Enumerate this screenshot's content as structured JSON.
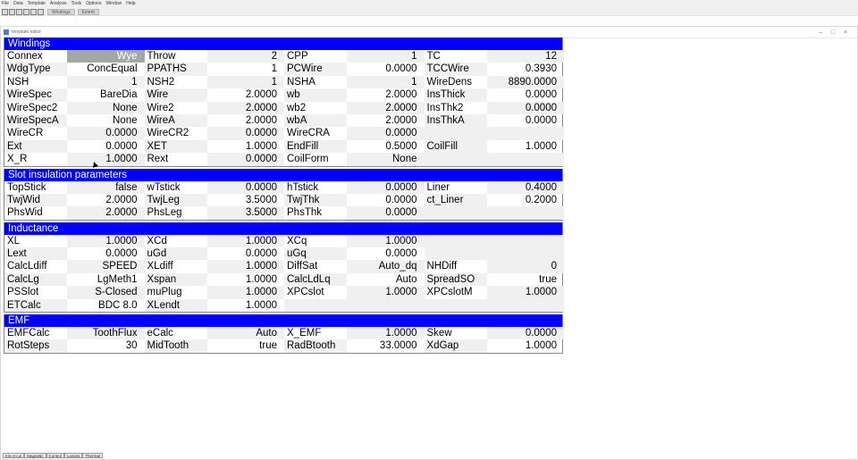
{
  "menu": [
    "File",
    "Data",
    "Template",
    "Analysis",
    "Tools",
    "Options",
    "Window",
    "Help"
  ],
  "toolbar": {
    "tabs": [
      "Windings",
      "Extent"
    ]
  },
  "window": {
    "title": "template editor"
  },
  "sections": [
    {
      "title": "Windings",
      "rows": [
        [
          [
            "Connex",
            "Wye"
          ],
          [
            "Throw",
            "2"
          ],
          [
            "CPP",
            "1"
          ],
          [
            "TC",
            "12"
          ]
        ],
        [
          [
            "WdgType",
            "ConcEqual"
          ],
          [
            "PPATHS",
            "1"
          ],
          [
            "PCWire",
            "0.0000"
          ],
          [
            "TCCWire",
            "0.3930"
          ]
        ],
        [
          [
            "NSH",
            "1"
          ],
          [
            "NSH2",
            "1"
          ],
          [
            "NSHA",
            "1"
          ],
          [
            "WireDens",
            "8890.0000"
          ]
        ],
        [
          [
            "WireSpec",
            "BareDia"
          ],
          [
            "Wire",
            "2.0000"
          ],
          [
            "wb",
            "2.0000"
          ],
          [
            "InsThick",
            "0.0000"
          ]
        ],
        [
          [
            "WireSpec2",
            "None"
          ],
          [
            "Wire2",
            "2.0000"
          ],
          [
            "wb2",
            "2.0000"
          ],
          [
            "InsThk2",
            "0.0000"
          ]
        ],
        [
          [
            "WireSpecA",
            "None"
          ],
          [
            "WireA",
            "2.0000"
          ],
          [
            "wbA",
            "2.0000"
          ],
          [
            "InsThkA",
            "0.0000"
          ]
        ],
        [
          [
            "WireCR",
            "0.0000"
          ],
          [
            "WireCR2",
            "0.0000"
          ],
          [
            "WireCRA",
            "0.0000"
          ],
          [
            "",
            ""
          ]
        ],
        [
          [
            "Ext",
            "0.0000"
          ],
          [
            "XET",
            "1.0000"
          ],
          [
            "EndFill",
            "0.5000"
          ],
          [
            "CoilFill",
            "1.0000"
          ]
        ],
        [
          [
            "X_R",
            "1.0000"
          ],
          [
            "Rext",
            "0.0000"
          ],
          [
            "CoilForm",
            "None"
          ],
          [
            "",
            ""
          ]
        ]
      ]
    },
    {
      "title": "Slot insulation parameters",
      "rows": [
        [
          [
            "TopStick",
            "false"
          ],
          [
            "wTstick",
            "0.0000"
          ],
          [
            "hTstick",
            "0.0000"
          ],
          [
            "Liner",
            "0.4000"
          ]
        ],
        [
          [
            "TwjWid",
            "2.0000"
          ],
          [
            "TwjLeg",
            "3.5000"
          ],
          [
            "TwjThk",
            "0.0000"
          ],
          [
            "ct_Liner",
            "0.2000"
          ]
        ],
        [
          [
            "PhsWid",
            "2.0000"
          ],
          [
            "PhsLeg",
            "3.5000"
          ],
          [
            "PhsThk",
            "0.0000"
          ],
          [
            "",
            ""
          ]
        ]
      ]
    },
    {
      "title": "Inductance",
      "rows": [
        [
          [
            "XL",
            "1.0000"
          ],
          [
            "XCd",
            "1.0000"
          ],
          [
            "XCq",
            "1.0000"
          ],
          [
            "",
            ""
          ]
        ],
        [
          [
            "Lext",
            "0.0000"
          ],
          [
            "uGd",
            "0.0000"
          ],
          [
            "uGq",
            "0.0000"
          ],
          [
            "",
            ""
          ]
        ],
        [
          [
            "CalcLdiff",
            "SPEED"
          ],
          [
            "XLdiff",
            "1.0000"
          ],
          [
            "DiffSat",
            "Auto_dq"
          ],
          [
            "NHDiff",
            "0"
          ]
        ],
        [
          [
            "CalcLg",
            "LgMeth1"
          ],
          [
            "Xspan",
            "1.0000"
          ],
          [
            "CalcLdLq",
            "Auto"
          ],
          [
            "SpreadSO",
            "true"
          ]
        ],
        [
          [
            "PSSlot",
            "S-Closed"
          ],
          [
            "muPlug",
            "1.0000"
          ],
          [
            "XPCslot",
            "1.0000"
          ],
          [
            "XPCslotM",
            "1.0000"
          ]
        ],
        [
          [
            "ETCalc",
            "BDC 8.0"
          ],
          [
            "XLendt",
            "1.0000"
          ],
          [
            "",
            ""
          ],
          [
            "",
            ""
          ]
        ]
      ]
    },
    {
      "title": "EMF",
      "rows": [
        [
          [
            "EMFCalc",
            "ToothFlux"
          ],
          [
            "eCalc",
            "Auto"
          ],
          [
            "X_EMF",
            "1.0000"
          ],
          [
            "Skew",
            "0.0000"
          ]
        ],
        [
          [
            "RotSteps",
            "30"
          ],
          [
            "MidTooth",
            "true"
          ],
          [
            "RadBtooth",
            "33.0000"
          ],
          [
            "XdGap",
            "1.0000"
          ]
        ]
      ]
    }
  ],
  "bottom_tabs": [
    "Electrical",
    "Magnetic",
    "Control",
    "Losses",
    "Thermal"
  ],
  "colors": {
    "section_header": "#0000ff",
    "selected_cell": "#a6a6a6",
    "shade": "#f0f0f0"
  }
}
